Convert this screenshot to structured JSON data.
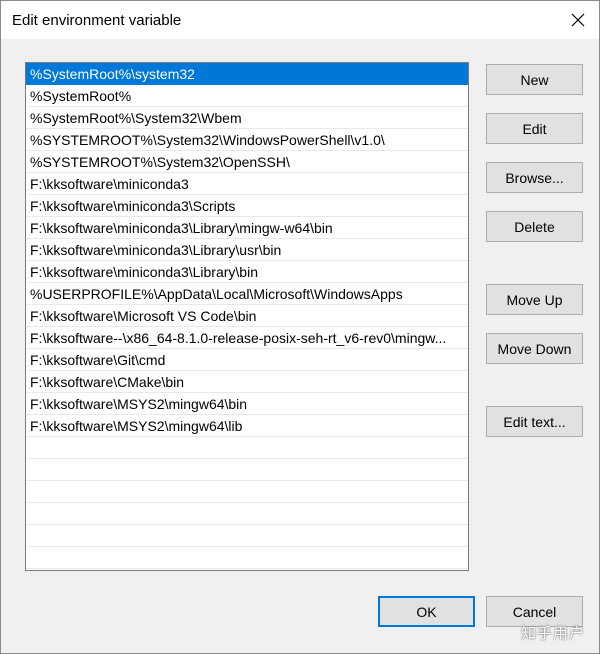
{
  "window": {
    "title": "Edit environment variable"
  },
  "paths": [
    "%SystemRoot%\\system32",
    "%SystemRoot%",
    "%SystemRoot%\\System32\\Wbem",
    "%SYSTEMROOT%\\System32\\WindowsPowerShell\\v1.0\\",
    "%SYSTEMROOT%\\System32\\OpenSSH\\",
    "F:\\kksoftware\\miniconda3",
    "F:\\kksoftware\\miniconda3\\Scripts",
    "F:\\kksoftware\\miniconda3\\Library\\mingw-w64\\bin",
    "F:\\kksoftware\\miniconda3\\Library\\usr\\bin",
    "F:\\kksoftware\\miniconda3\\Library\\bin",
    "%USERPROFILE%\\AppData\\Local\\Microsoft\\WindowsApps",
    "F:\\kksoftware\\Microsoft VS Code\\bin",
    "F:\\kksoftware--\\x86_64-8.1.0-release-posix-seh-rt_v6-rev0\\mingw...",
    "F:\\kksoftware\\Git\\cmd",
    "F:\\kksoftware\\CMake\\bin",
    "F:\\kksoftware\\MSYS2\\mingw64\\bin",
    "F:\\kksoftware\\MSYS2\\mingw64\\lib",
    "",
    "",
    "",
    "",
    "",
    "",
    ""
  ],
  "selected_index": 0,
  "buttons": {
    "new": "New",
    "edit": "Edit",
    "browse": "Browse...",
    "delete": "Delete",
    "move_up": "Move Up",
    "move_down": "Move Down",
    "edit_text": "Edit text...",
    "ok": "OK",
    "cancel": "Cancel"
  },
  "watermark": "知乎用户",
  "colors": {
    "selection": "#0078d7",
    "default_button_border": "#0078d7"
  }
}
